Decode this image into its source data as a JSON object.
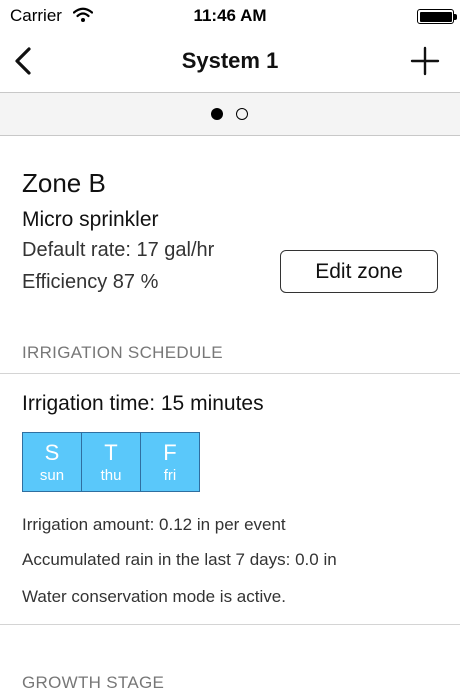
{
  "status_bar": {
    "carrier": "Carrier",
    "time": "11:46 AM",
    "wifi_icon": "wifi-icon",
    "battery_icon": "battery-icon"
  },
  "nav": {
    "title": "System 1",
    "back_icon": "chevron-left-icon",
    "add_icon": "plus-icon"
  },
  "pager": {
    "page_count": 2,
    "current_page": 1
  },
  "zone": {
    "name": "Zone B",
    "type": "Micro sprinkler",
    "rate": "Default rate: 17 gal/hr",
    "efficiency": "Efficiency 87 %",
    "edit_label": "Edit zone"
  },
  "irrigation": {
    "header": "IRRIGATION SCHEDULE",
    "time": "Irrigation time: 15 minutes",
    "days": [
      {
        "letter": "S",
        "name": "sun"
      },
      {
        "letter": "T",
        "name": "thu"
      },
      {
        "letter": "F",
        "name": "fri"
      }
    ],
    "amount": "Irrigation amount: 0.12 in per event",
    "rain": "Accumulated rain in the last 7 days: 0.0 in",
    "conservation": "Water conservation mode is active."
  },
  "growth": {
    "header": "GROWTH STAGE"
  },
  "colors": {
    "day_fill": "#5ac8fa",
    "day_border": "#2f6fa0",
    "pager_bg": "#f4f4f4",
    "section_header": "#777777"
  }
}
